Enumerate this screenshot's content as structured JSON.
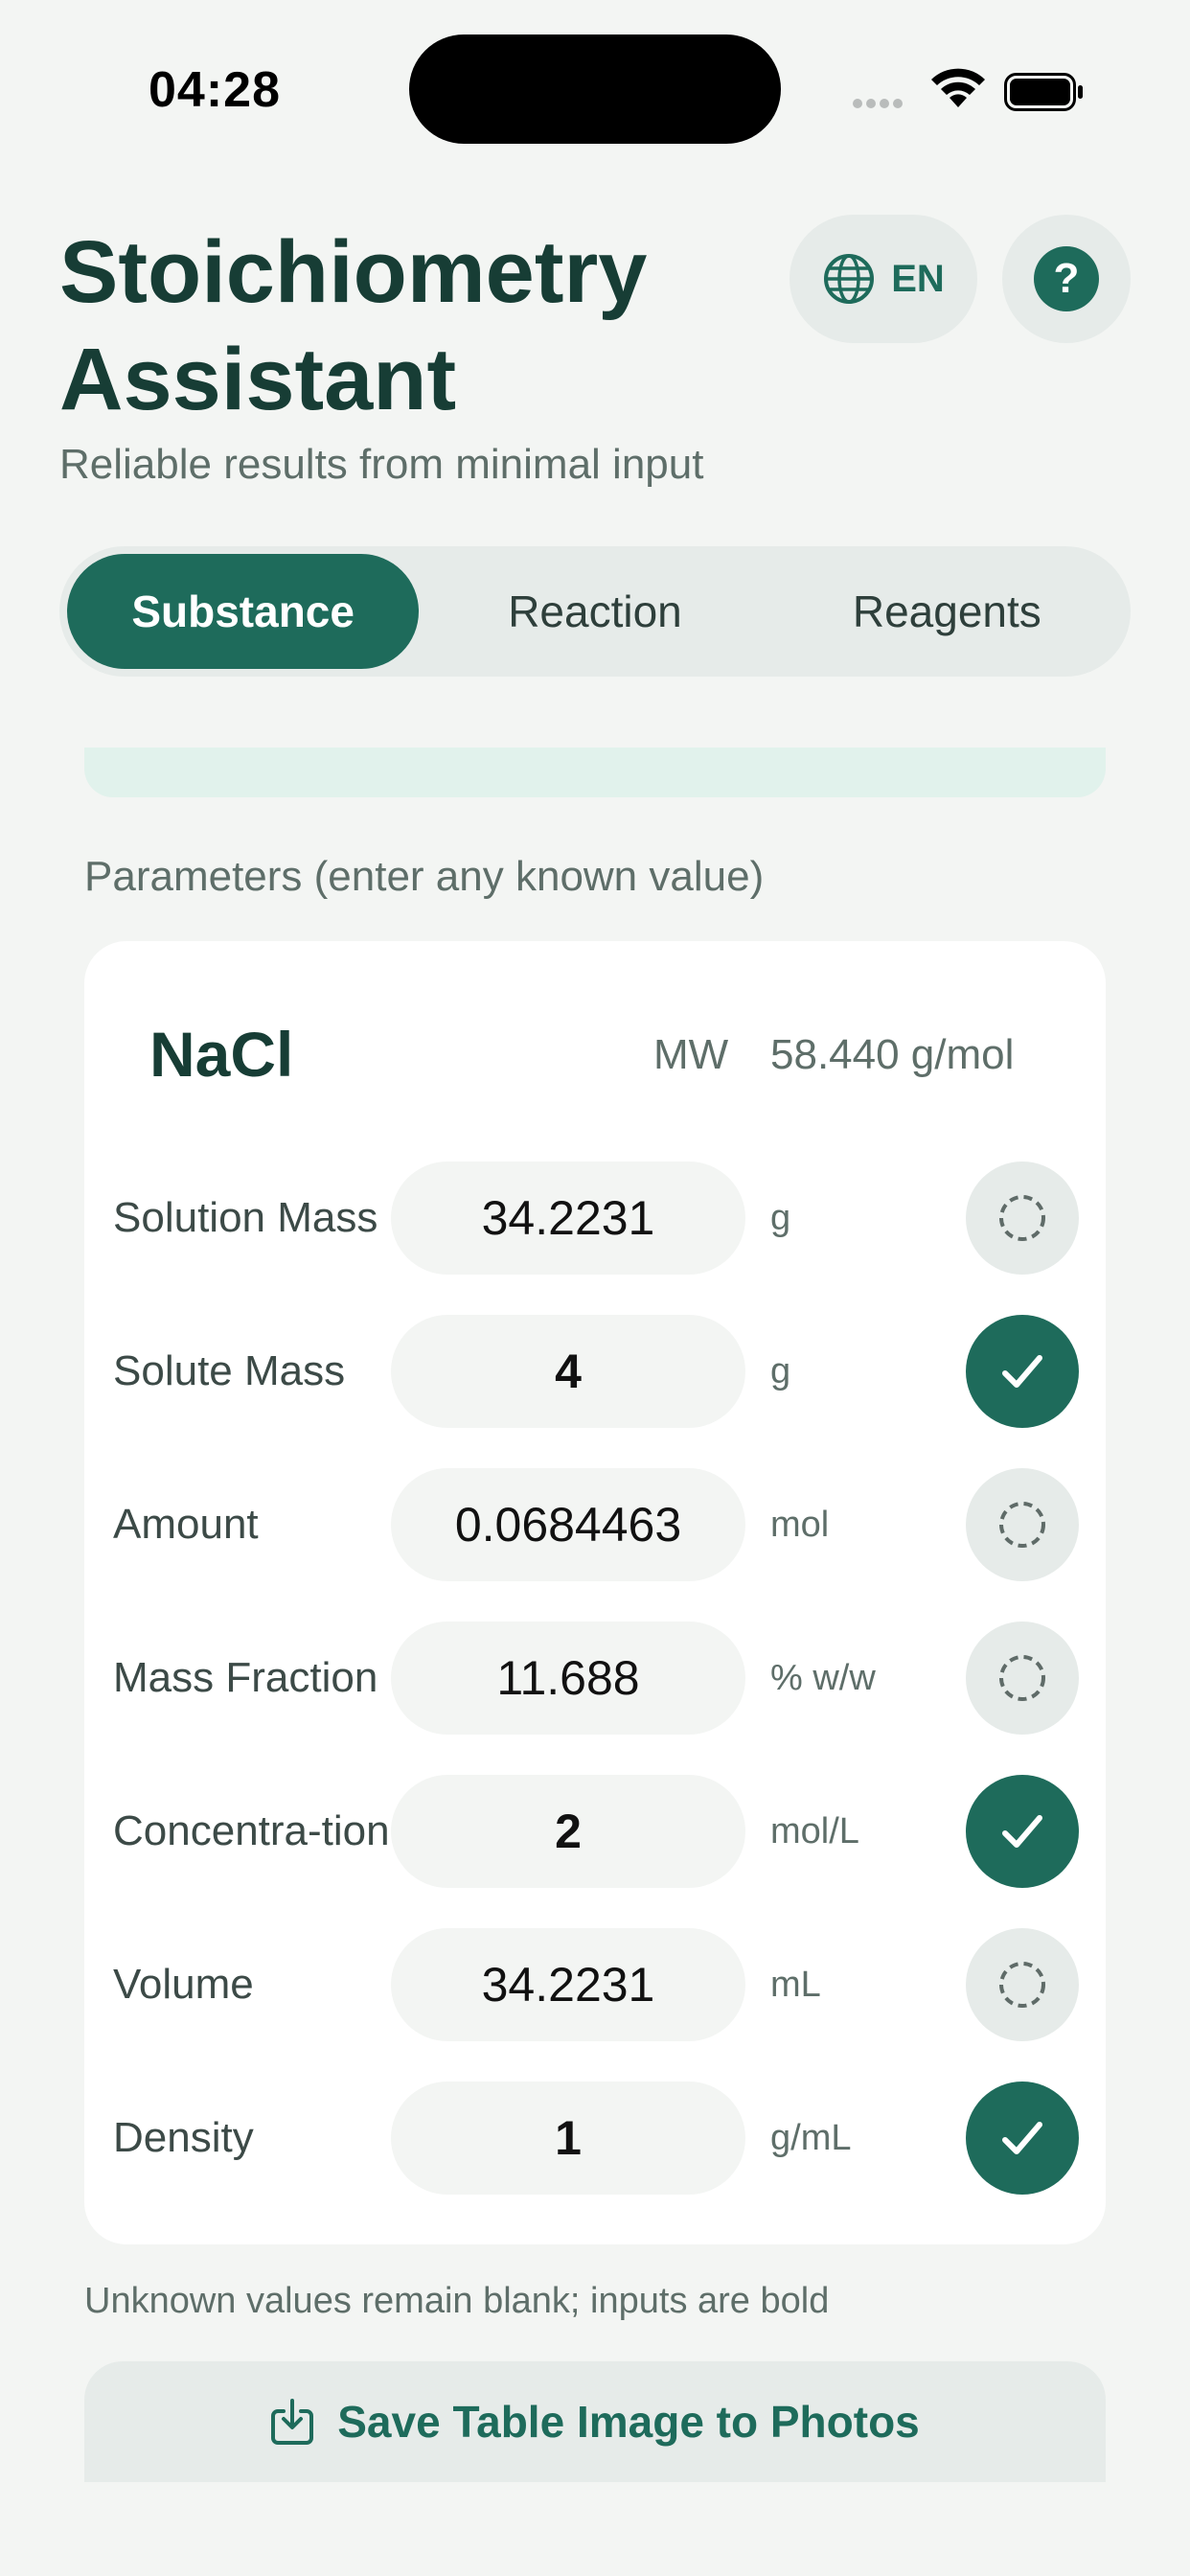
{
  "status_bar": {
    "time": "04:28"
  },
  "header": {
    "title": "Stoichiometry Assistant",
    "subtitle": "Reliable results from minimal input",
    "language_label": "EN",
    "help_label": "?"
  },
  "tabs": [
    {
      "label": "Substance",
      "active": true
    },
    {
      "label": "Reaction",
      "active": false
    },
    {
      "label": "Reagents",
      "active": false
    }
  ],
  "parameters": {
    "section_label": "Parameters (enter any known value)",
    "formula": "NaCl",
    "mw_label": "MW",
    "mw_value": "58.440 g/mol",
    "rows": [
      {
        "label": "Solution Mass",
        "value": "34.2231",
        "unit": "g",
        "known": false
      },
      {
        "label": "Solute Mass",
        "value": "4",
        "unit": "g",
        "known": true
      },
      {
        "label": "Amount",
        "value": "0.0684463",
        "unit": "mol",
        "known": false
      },
      {
        "label": "Mass Fraction",
        "value": "11.688",
        "unit": "% w/w",
        "known": false
      },
      {
        "label": "Concentra-tion",
        "value": "2",
        "unit": "mol/L",
        "known": true
      },
      {
        "label": "Volume",
        "value": "34.2231",
        "unit": "mL",
        "known": false
      },
      {
        "label": "Density",
        "value": "1",
        "unit": "g/mL",
        "known": true
      }
    ]
  },
  "footnote": "Unknown values remain blank; inputs are bold",
  "save_button": {
    "label": "Save Table Image to Photos"
  },
  "colors": {
    "accent": "#1e6b5b",
    "background": "#f3f5f3",
    "chip": "#e6ebe9"
  }
}
